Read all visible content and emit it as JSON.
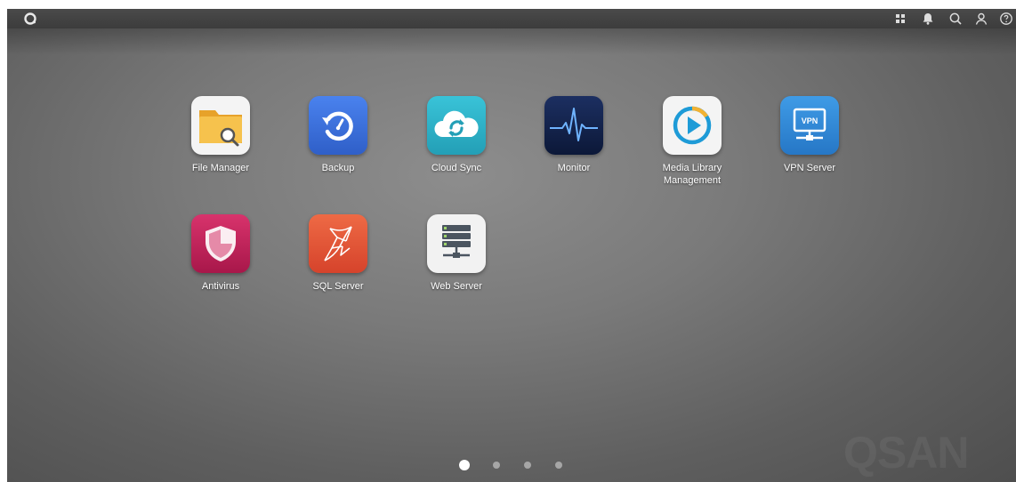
{
  "topbar": {
    "logo_icon": "qsan-logo-icon",
    "icons": [
      "apps-grid-icon",
      "bell-icon",
      "search-icon",
      "user-icon",
      "help-icon"
    ]
  },
  "apps": [
    {
      "label": "File Manager",
      "icon": "file-manager-icon"
    },
    {
      "label": "Backup",
      "icon": "backup-icon"
    },
    {
      "label": "Cloud Sync",
      "icon": "cloud-sync-icon"
    },
    {
      "label": "Monitor",
      "icon": "monitor-icon"
    },
    {
      "label": "Media Library\nManagement",
      "icon": "media-library-icon"
    },
    {
      "label": "VPN Server",
      "icon": "vpn-server-icon",
      "badge": "VPN"
    },
    {
      "label": "Antivirus",
      "icon": "antivirus-icon"
    },
    {
      "label": "SQL Server",
      "icon": "sql-server-icon"
    },
    {
      "label": "Web Server",
      "icon": "web-server-icon"
    }
  ],
  "pagination": {
    "pages": 4,
    "current": 1
  },
  "watermark": "QSAN",
  "colors": {
    "backup": "#3a6fd8",
    "cloud_sync": "#2fb3c9",
    "monitor": "#14244d",
    "vpn": "#2f8ad6",
    "antivirus": "#c2245a",
    "sql": "#e4553a"
  }
}
